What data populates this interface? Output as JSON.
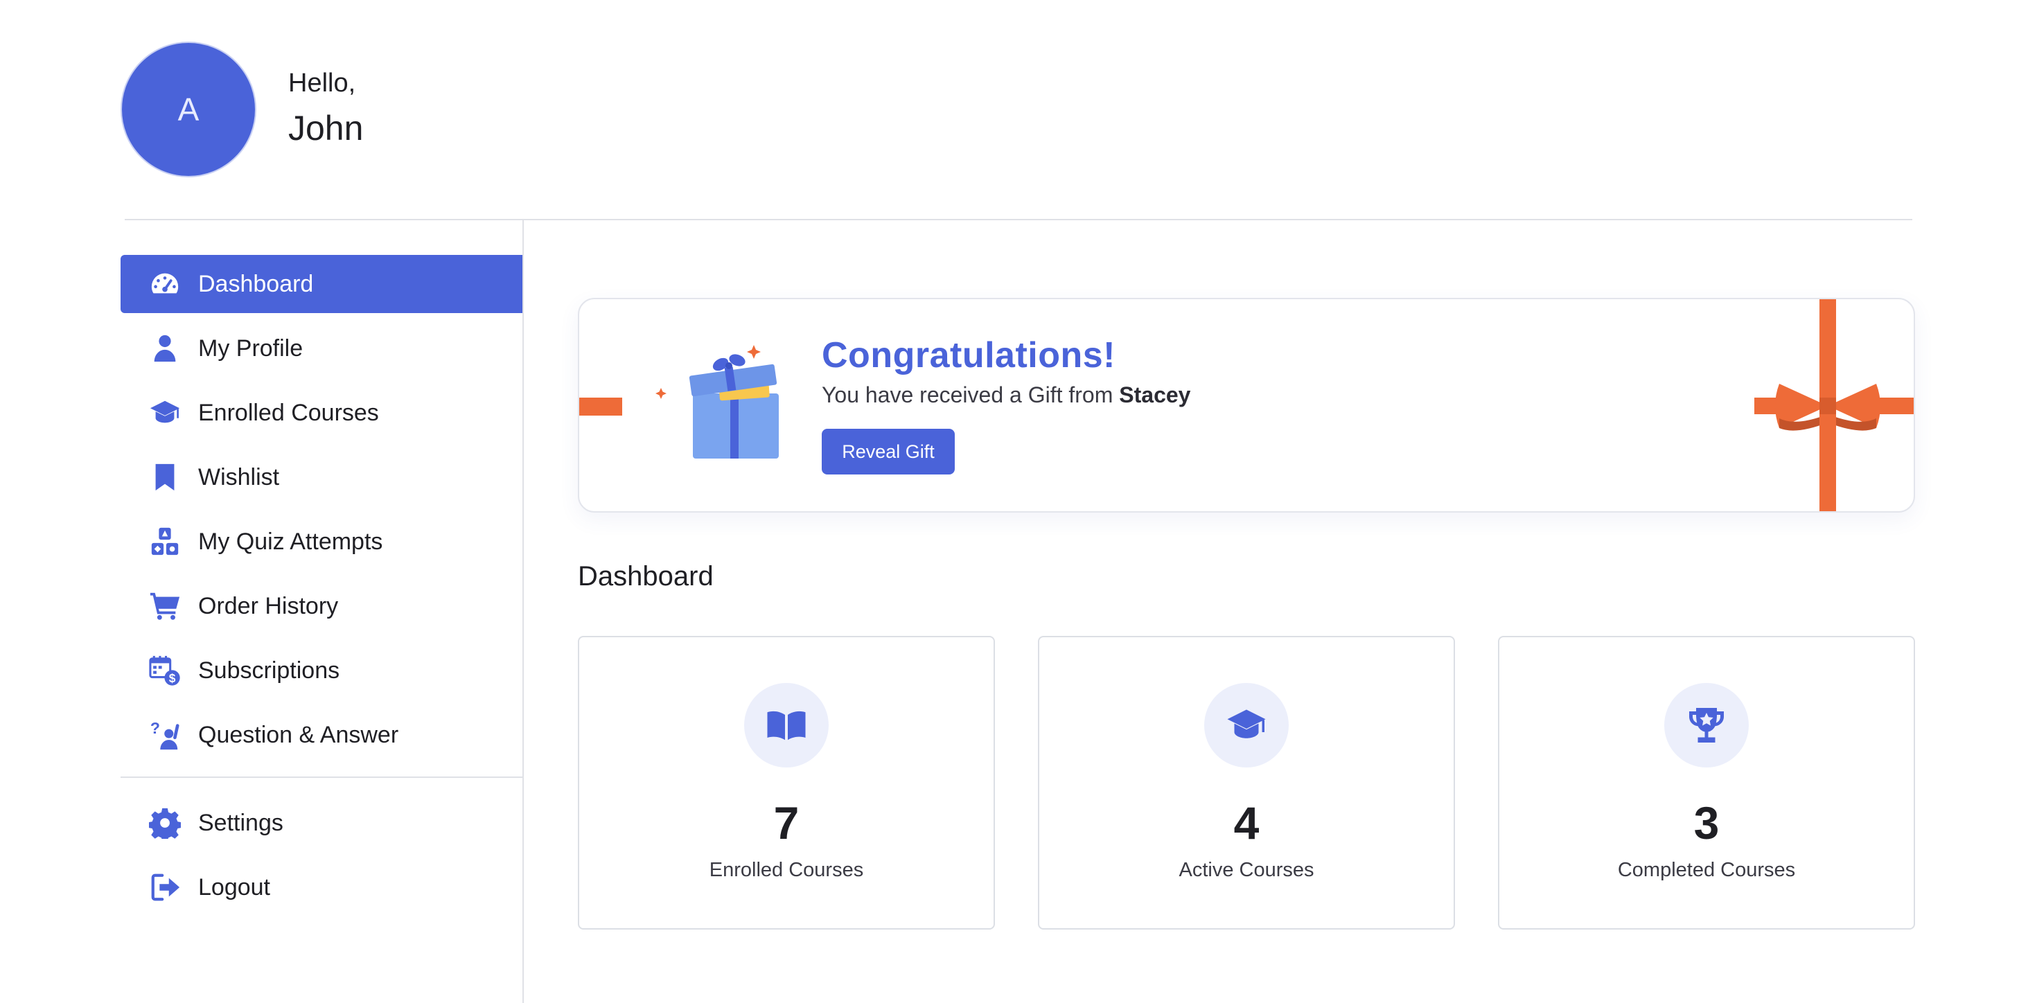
{
  "user": {
    "avatar_initial": "A",
    "greeting": "Hello,",
    "name": "John"
  },
  "sidebar": {
    "items": [
      {
        "label": "Dashboard",
        "icon": "dashboard-gauge-icon",
        "active": true
      },
      {
        "label": "My Profile",
        "icon": "user-icon"
      },
      {
        "label": "Enrolled Courses",
        "icon": "graduation-cap-icon"
      },
      {
        "label": "Wishlist",
        "icon": "bookmark-icon"
      },
      {
        "label": "My Quiz Attempts",
        "icon": "quiz-blocks-icon"
      },
      {
        "label": "Order History",
        "icon": "cart-icon"
      },
      {
        "label": "Subscriptions",
        "icon": "calendar-dollar-icon"
      },
      {
        "label": "Question & Answer",
        "icon": "question-person-icon"
      }
    ],
    "footer_items": [
      {
        "label": "Settings",
        "icon": "gear-icon"
      },
      {
        "label": "Logout",
        "icon": "logout-icon"
      }
    ]
  },
  "banner": {
    "title": "Congratulations!",
    "subtitle_prefix": "You have received a Gift from ",
    "sender": "Stacey",
    "button_label": "Reveal Gift"
  },
  "dashboard": {
    "title": "Dashboard",
    "stats": [
      {
        "value": "7",
        "label": "Enrolled Courses",
        "icon": "open-book-icon"
      },
      {
        "value": "4",
        "label": "Active Courses",
        "icon": "graduation-cap-icon"
      },
      {
        "value": "3",
        "label": "Completed Courses",
        "icon": "trophy-icon"
      }
    ]
  },
  "colors": {
    "accent": "#4a63d9",
    "ribbon": "#ee6b38",
    "gift_box": "#7aa4ef",
    "icon_bg": "#eceffb"
  }
}
